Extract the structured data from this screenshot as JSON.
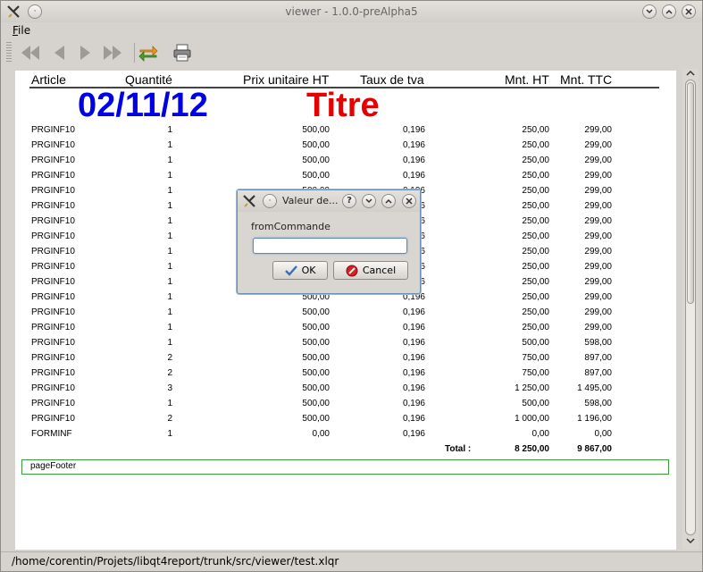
{
  "window": {
    "title": "viewer - 1.0.0-preAlpha5"
  },
  "menubar": {
    "file_label_first": "F",
    "file_label_rest": "ile"
  },
  "toolbar": {
    "icons": [
      "first-page-icon",
      "previous-page-icon",
      "next-page-icon",
      "last-page-icon",
      "refresh-icon",
      "print-icon"
    ]
  },
  "report": {
    "headers": [
      "Article",
      "Quantité",
      "Prix unitaire HT",
      "Taux de tva",
      "Mnt. HT",
      "Mnt. TTC"
    ],
    "date": "02/11/12",
    "title": "Titre",
    "rows": [
      [
        "PRGINF10",
        "1",
        "500,00",
        "0,196",
        "250,00",
        "299,00"
      ],
      [
        "PRGINF10",
        "1",
        "500,00",
        "0,196",
        "250,00",
        "299,00"
      ],
      [
        "PRGINF10",
        "1",
        "500,00",
        "0,196",
        "250,00",
        "299,00"
      ],
      [
        "PRGINF10",
        "1",
        "500,00",
        "0,196",
        "250,00",
        "299,00"
      ],
      [
        "PRGINF10",
        "1",
        "500,00",
        "0,196",
        "250,00",
        "299,00"
      ],
      [
        "PRGINF10",
        "1",
        "500,00",
        "0,196",
        "250,00",
        "299,00"
      ],
      [
        "PRGINF10",
        "1",
        "500,00",
        "0,196",
        "250,00",
        "299,00"
      ],
      [
        "PRGINF10",
        "1",
        "500,00",
        "0,196",
        "250,00",
        "299,00"
      ],
      [
        "PRGINF10",
        "1",
        "500,00",
        "0,196",
        "250,00",
        "299,00"
      ],
      [
        "PRGINF10",
        "1",
        "500,00",
        "0,196",
        "250,00",
        "299,00"
      ],
      [
        "PRGINF10",
        "1",
        "500,00",
        "0,196",
        "250,00",
        "299,00"
      ],
      [
        "PRGINF10",
        "1",
        "500,00",
        "0,196",
        "250,00",
        "299,00"
      ],
      [
        "PRGINF10",
        "1",
        "500,00",
        "0,196",
        "250,00",
        "299,00"
      ],
      [
        "PRGINF10",
        "1",
        "500,00",
        "0,196",
        "250,00",
        "299,00"
      ],
      [
        "PRGINF10",
        "1",
        "500,00",
        "0,196",
        "500,00",
        "598,00"
      ],
      [
        "PRGINF10",
        "2",
        "500,00",
        "0,196",
        "750,00",
        "897,00"
      ],
      [
        "PRGINF10",
        "2",
        "500,00",
        "0,196",
        "750,00",
        "897,00"
      ],
      [
        "PRGINF10",
        "3",
        "500,00",
        "0,196",
        "1 250,00",
        "1 495,00"
      ],
      [
        "PRGINF10",
        "1",
        "500,00",
        "0,196",
        "500,00",
        "598,00"
      ],
      [
        "PRGINF10",
        "2",
        "500,00",
        "0,196",
        "1 000,00",
        "1 196,00"
      ],
      [
        "FORMINF",
        "1",
        "0,00",
        "0,196",
        "0,00",
        "0,00"
      ]
    ],
    "total_label": "Total :",
    "total_ht": "8 250,00",
    "total_ttc": "9 867,00",
    "footer_label": "pageFooter"
  },
  "dialog": {
    "title": "Valeur de...",
    "field_label": "fromCommande",
    "input_value": "",
    "ok_label": "OK",
    "cancel_label": "Cancel"
  },
  "statusbar": {
    "path": "/home/corentin/Projets/libqt4report/trunk/src/viewer/test.xlqr"
  },
  "colors": {
    "date": "#0000e6",
    "title": "#e60000",
    "footer_border": "#3a9a3a"
  }
}
